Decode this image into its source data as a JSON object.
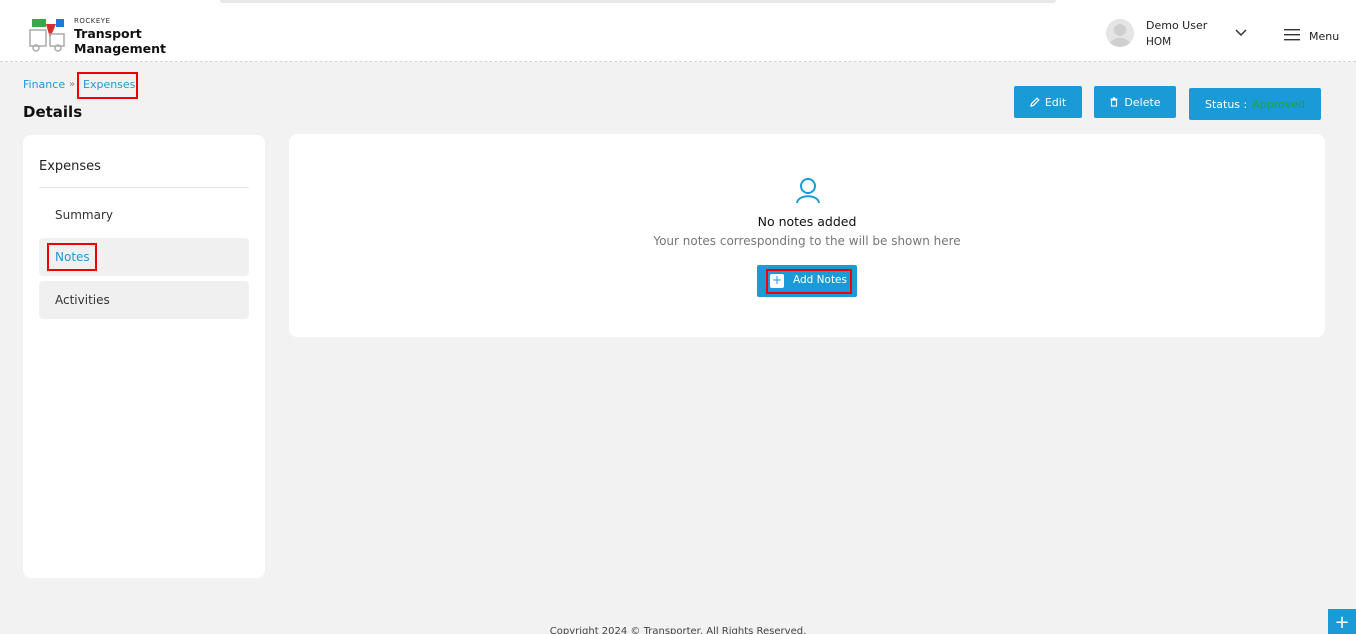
{
  "header": {
    "brand_small": "ROCKEYE",
    "brand_line1": "Transport",
    "brand_line2": "Management",
    "user_name": "Demo User",
    "user_role": "HOM",
    "menu_label": "Menu"
  },
  "breadcrumb": {
    "items": [
      "Finance",
      "Expenses"
    ],
    "separator": "»"
  },
  "page_title": "Details",
  "actions": {
    "edit_label": "Edit",
    "delete_label": "Delete",
    "status_label": "Status :",
    "status_value": "Approved"
  },
  "sidebar": {
    "title": "Expenses",
    "items": [
      {
        "label": "Summary"
      },
      {
        "label": "Notes"
      },
      {
        "label": "Activities"
      }
    ]
  },
  "notes": {
    "empty_title": "No notes added",
    "empty_description": "Your notes corresponding to the will be shown here",
    "add_label": "Add Notes",
    "add_icon": "+"
  },
  "footer": {
    "copyright": "Copyright 2024 © Transporter. All Rights Reserved."
  },
  "fab_icon": "+",
  "colors": {
    "accent": "#1a9ad6",
    "status_approved": "#1ea33a",
    "highlight_box": "#e00000"
  }
}
